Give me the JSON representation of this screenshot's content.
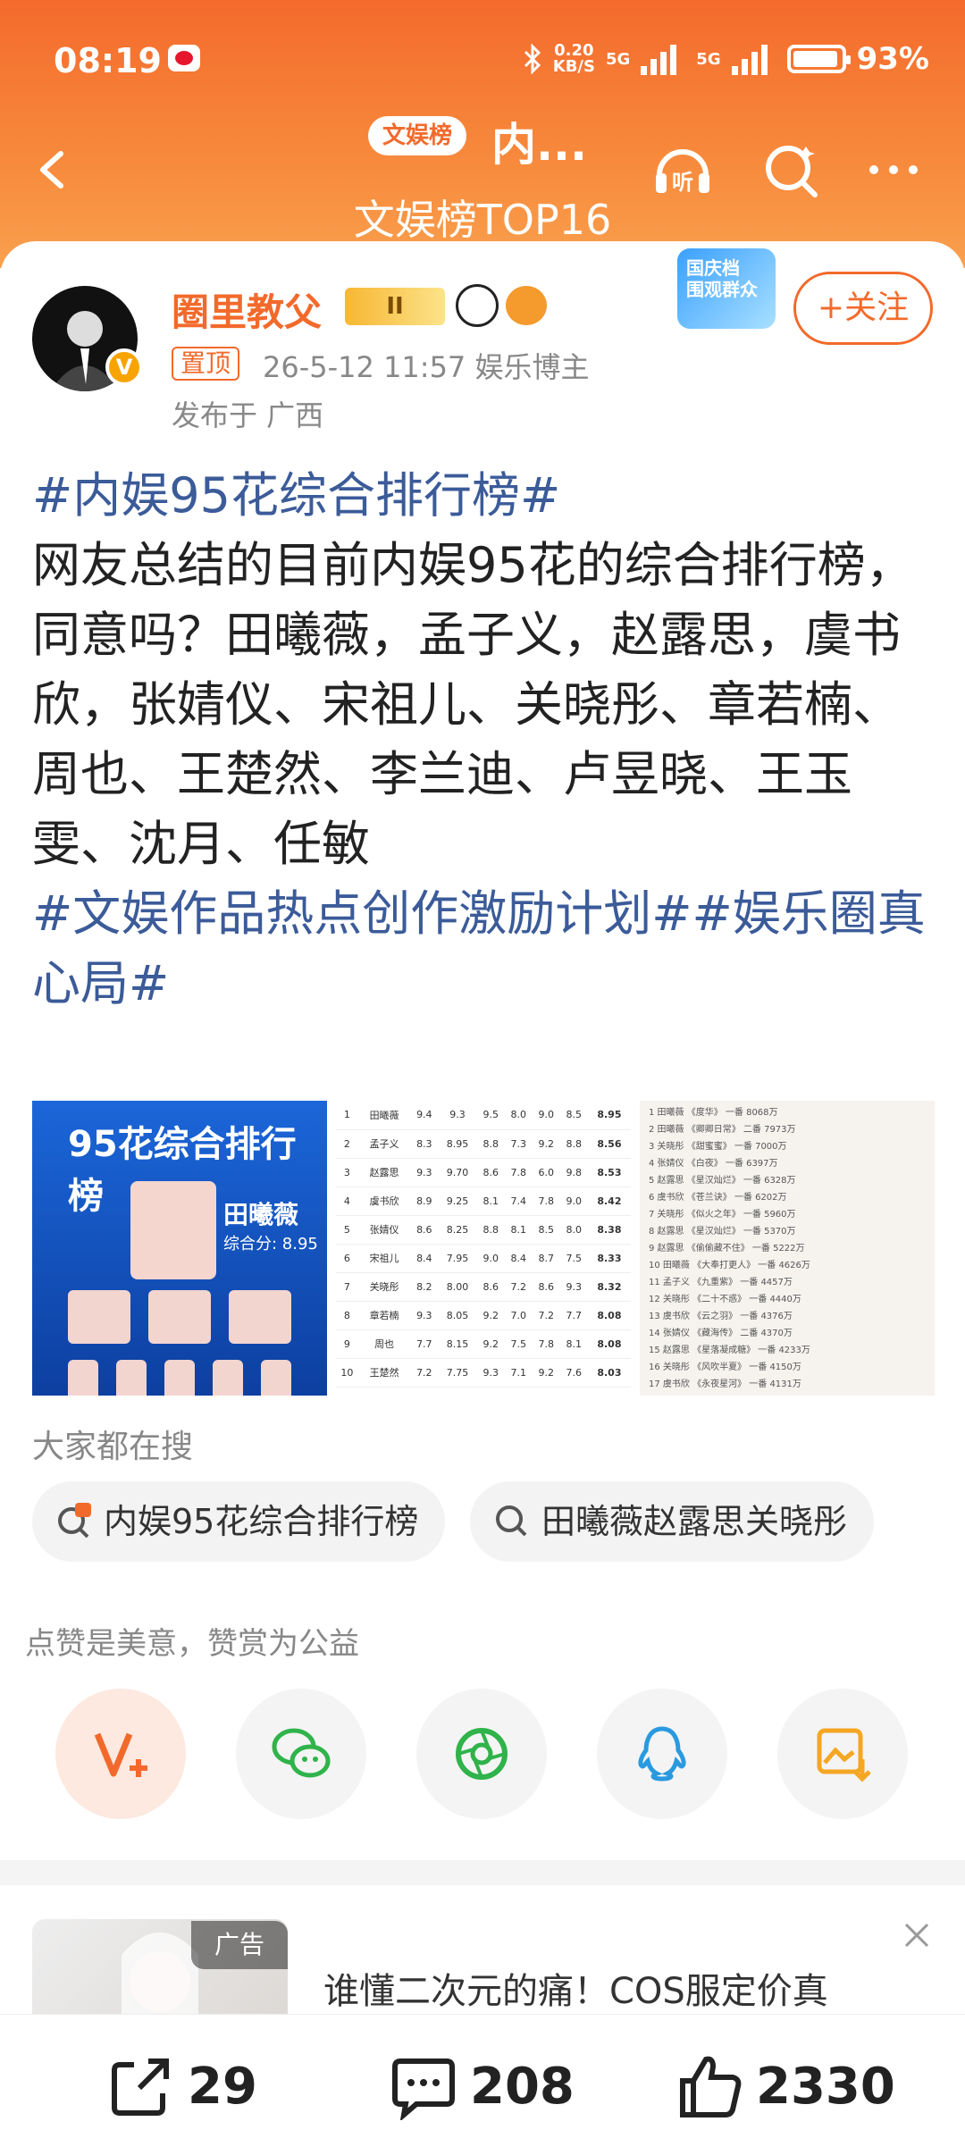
{
  "status_bar": {
    "time": "08:19",
    "speed_value": "0.20",
    "speed_unit": "KB/S",
    "net1": "5G",
    "net2": "5G",
    "battery": "93%"
  },
  "nav": {
    "tag": "文娱榜",
    "title": "内...",
    "subtitle": "文娱榜TOP16"
  },
  "author": {
    "name": "圈里教父",
    "level": "II",
    "pin_tag": "置顶",
    "meta": "26-5-12 11:57  娱乐博主",
    "location": "发布于 广西",
    "verified_badge": "V",
    "promo": "国庆档\n围观群众",
    "follow_label": "+关注"
  },
  "post": {
    "tag1": "#内娱95花综合排行榜#",
    "body": "网友总结的目前内娱95花的综合排行榜，同意吗？田曦薇，孟子义，赵露思，虞书欣，张婧仪、宋祖儿、关晓彤、章若楠、周也、王楚然、李兰迪、卢昱晓、王玉雯、沈月、任敏",
    "tag2": "#文娱作品热点创作激励计划##娱乐圈真心局#"
  },
  "images": {
    "img1": {
      "title": "95花综合排行榜",
      "top_name": "田曦薇",
      "top_score": "综合分: 8.95"
    },
    "img2_rows": [
      [
        "1",
        "田曦薇",
        "9.4",
        "9.3",
        "9.5",
        "8.0",
        "9.0",
        "8.5",
        "8.95"
      ],
      [
        "2",
        "孟子义",
        "8.3",
        "8.95",
        "8.8",
        "7.3",
        "9.2",
        "8.8",
        "8.56"
      ],
      [
        "3",
        "赵露思",
        "9.3",
        "9.70",
        "8.6",
        "7.8",
        "6.0",
        "9.8",
        "8.53"
      ],
      [
        "4",
        "虞书欣",
        "8.9",
        "9.25",
        "8.1",
        "7.4",
        "7.8",
        "9.0",
        "8.42"
      ],
      [
        "5",
        "张婧仪",
        "8.6",
        "8.25",
        "8.8",
        "8.1",
        "8.5",
        "8.0",
        "8.38"
      ],
      [
        "6",
        "宋祖儿",
        "8.4",
        "7.95",
        "9.0",
        "8.4",
        "8.7",
        "7.5",
        "8.33"
      ],
      [
        "7",
        "关晓彤",
        "8.2",
        "8.00",
        "8.6",
        "7.2",
        "8.6",
        "9.3",
        "8.32"
      ],
      [
        "8",
        "章若楠",
        "9.3",
        "8.05",
        "9.2",
        "7.0",
        "7.2",
        "7.7",
        "8.08"
      ],
      [
        "9",
        "周也",
        "7.7",
        "8.15",
        "9.2",
        "7.5",
        "7.8",
        "8.1",
        "8.08"
      ],
      [
        "10",
        "王楚然",
        "7.2",
        "7.75",
        "9.3",
        "7.1",
        "9.2",
        "7.6",
        "8.03"
      ]
    ],
    "img3_rows": [
      "田曦薇 《度华》 一番 8068万",
      "田曦薇 《卿卿日常》 二番 7973万",
      "关晓彤 《甜蜜蜜》 一番 7000万",
      "张婧仪 《白夜》 一番 6397万",
      "赵露思 《星汉灿烂》 一番 6328万",
      "虞书欣 《苍兰诀》 一番 6202万",
      "关晓彤 《似火之年》 一番 5960万",
      "赵露思 《星汉灿烂》 一番 5370万",
      "赵露思 《偷偷藏不住》 一番 5222万",
      "田曦薇 《大奉打更人》 一番 4626万",
      "孟子义 《九重紫》 一番 4457万",
      "关晓彤 《二十不惑》 一番 4440万",
      "虞书欣 《云之羽》 一番 4376万",
      "张婧仪 《藏海传》 二番 4370万",
      "赵露思 《星落凝成糖》 一番 4233万",
      "关晓彤 《风吹半夏》 一番 4150万",
      "虞书欣 《永夜星河》 一番 4131万"
    ]
  },
  "search": {
    "title": "大家都在搜",
    "chip1": "内娱95花综合排行榜",
    "chip2": "田曦薇赵露思关晓彤"
  },
  "reward_text": "点赞是美意，赞赏为公益",
  "ad": {
    "tag": "广告",
    "text": "谁懂二次元的痛！COS服定价真"
  },
  "actions": {
    "share": "29",
    "comment": "208",
    "like": "2330"
  },
  "colors": {
    "accent": "#f26a2b",
    "tag_blue": "#3b5b99",
    "header_top": "#f46a2c"
  }
}
